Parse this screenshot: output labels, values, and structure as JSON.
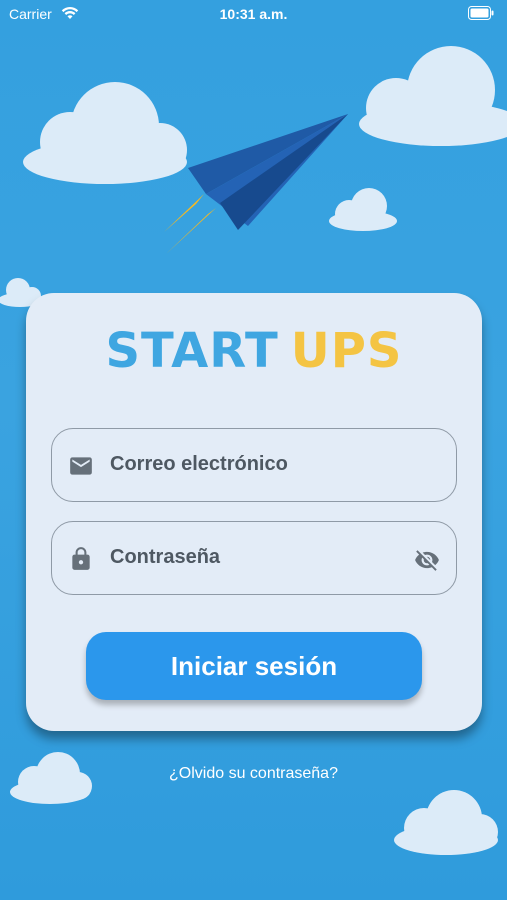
{
  "status_bar": {
    "carrier": "Carrier",
    "time": "10:31 a.m."
  },
  "logo": {
    "part1": "START",
    "part2": "UPS"
  },
  "form": {
    "email_placeholder": "Correo electrónico",
    "password_placeholder": "Contraseña",
    "login_label": "Iniciar sesión"
  },
  "forgot_link": "¿Olvido su contraseña?",
  "colors": {
    "background": "#34a0df",
    "card": "#e3ecf7",
    "logo_blue": "#3fa6e1",
    "logo_yellow": "#f4c443",
    "button": "#2b97ec"
  },
  "icons": [
    "wifi-icon",
    "battery-icon",
    "paper-plane-icon",
    "mail-icon",
    "lock-icon",
    "eye-off-icon"
  ]
}
